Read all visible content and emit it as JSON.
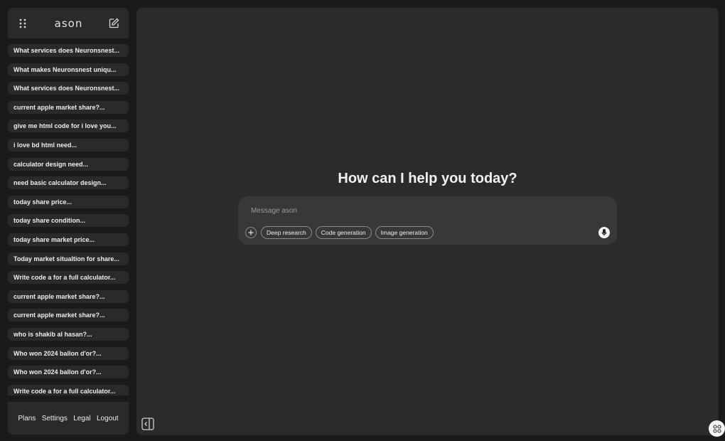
{
  "sidebar": {
    "brand": "ason",
    "icons": {
      "menu": "grid-dots-icon",
      "new_chat": "edit-icon"
    },
    "chats": [
      "What services does Neuronsnest...",
      "What makes Neuronsnest uniqu...",
      "What services does Neuronsnest...",
      "current apple market share?...",
      "give me html code for i love you...",
      "i love bd html need...",
      "calculator design need...",
      "need basic calculator design...",
      "today share price...",
      "today share condition...",
      "today share market price...",
      "Today market situaltion for share...",
      "Write code a for a full calculator...",
      "current apple market share?...",
      "current apple market share?...",
      "who is shakib al hasan?...",
      "Who won 2024 ballon d'or?...",
      "Who won 2024 ballon d'or?...",
      "Write code a for a full calculator..."
    ],
    "footer": [
      "Plans",
      "Settings",
      "Legal",
      "Logout"
    ]
  },
  "main": {
    "headline": "How can I help you today?",
    "composer": {
      "placeholder": "Message ason",
      "value": "",
      "chips": [
        "Deep research",
        "Code generation",
        "Image generation"
      ],
      "icons": {
        "attach": "plus-icon",
        "voice": "microphone-icon"
      }
    }
  },
  "controls": {
    "icons": {
      "collapse": "sidebar-collapse-icon",
      "corner": "command-icon"
    }
  },
  "colors": {
    "background": "#1a1a1a",
    "panel": "#2a2a2a",
    "main": "#2b2b2b",
    "composer": "#383838",
    "text": "#ececec"
  }
}
